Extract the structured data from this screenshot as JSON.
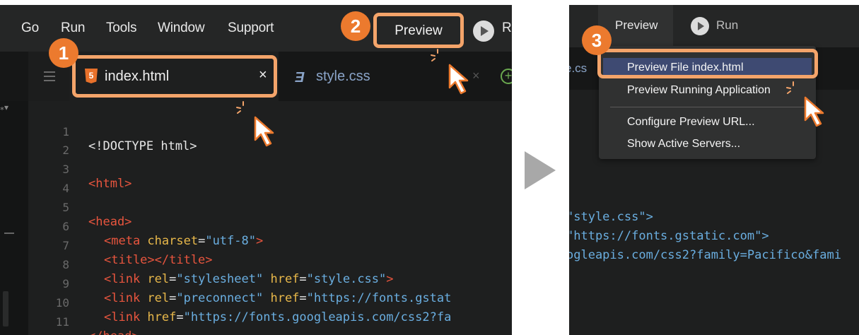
{
  "left": {
    "menu": [
      "Go",
      "Run",
      "Tools",
      "Window",
      "Support"
    ],
    "preview_label": "Preview",
    "run_label": "R",
    "tabs": [
      {
        "label": "index.html",
        "icon": "html5-icon",
        "close": "×"
      },
      {
        "label": "style.css",
        "icon": "css3-icon"
      }
    ],
    "code_lines": [
      {
        "n": "1"
      },
      {
        "n": "2"
      },
      {
        "n": "3"
      },
      {
        "n": "4"
      },
      {
        "n": "5"
      },
      {
        "n": "6"
      },
      {
        "n": "7"
      },
      {
        "n": "8"
      },
      {
        "n": "9"
      },
      {
        "n": "10"
      },
      {
        "n": "11"
      },
      {
        "n": "12"
      }
    ],
    "code": {
      "l1": "<!DOCTYPE html>",
      "l3": "<html>",
      "l5": "<head>",
      "l6_tag": "<meta ",
      "l6_attr": "charset",
      "l6_eq": "=",
      "l6_str": "\"utf-8\"",
      "l6_end": ">",
      "l7": "<title></title>",
      "l8_tag": "<link ",
      "l8_attr1": "rel",
      "l8_str1": "\"stylesheet\"",
      "l8_attr2": "href",
      "l8_str2": "\"style.css\"",
      "l8_end": ">",
      "l9_tag": "<link ",
      "l9_attr1": "rel",
      "l9_str1": "\"preconnect\"",
      "l9_attr2": "href",
      "l9_str2": "\"https://fonts.gstat",
      "l10_tag": "<link ",
      "l10_attr": "href",
      "l10_str": "\"https://fonts.googleapis.com/css2?fa",
      "l11": "</head>"
    }
  },
  "right": {
    "preview_label": "Preview",
    "run_label": "Run",
    "tab_fragment": "e.cs",
    "dropdown": [
      "Preview File index.html",
      "Preview Running Application",
      "Configure Preview URL...",
      "Show Active Servers..."
    ],
    "code_lines": [
      "\"style.css\">",
      "\"https://fonts.gstatic.com\">",
      "ogleapis.com/css2?family=Pacifico&fami"
    ]
  },
  "badges": [
    "1",
    "2",
    "3"
  ],
  "colors": {
    "accent": "#ec7a2e",
    "highlight": "#f4a46a",
    "tag": "#e8553e",
    "attr": "#e8b84a",
    "string": "#6aaee0"
  }
}
